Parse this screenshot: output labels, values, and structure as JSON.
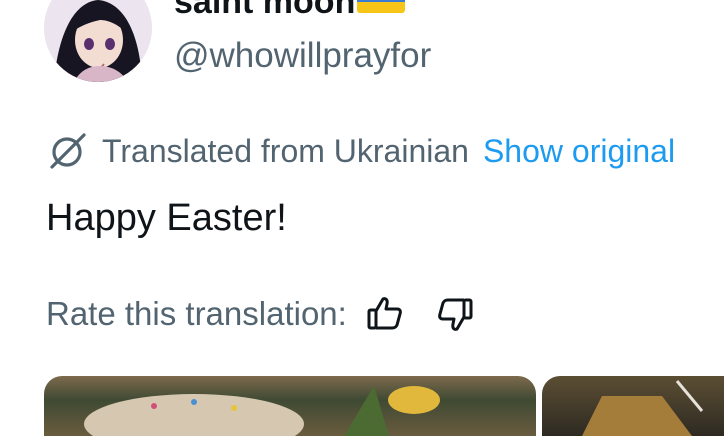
{
  "author": {
    "display_name": "saint moon",
    "flag": "flag-ukraine-icon",
    "handle": "@whowillprayfor"
  },
  "translation": {
    "notice": "Translated from Ukrainian",
    "show_original_label": "Show original"
  },
  "tweet": {
    "text": "Happy Easter!"
  },
  "rating": {
    "label": "Rate this translation:",
    "thumbs_up_icon": "thumbs-up-icon",
    "thumbs_down_icon": "thumbs-down-icon"
  },
  "colors": {
    "link": "#1d9bf0",
    "secondary_text": "#536471",
    "primary_text": "#0f1419"
  }
}
